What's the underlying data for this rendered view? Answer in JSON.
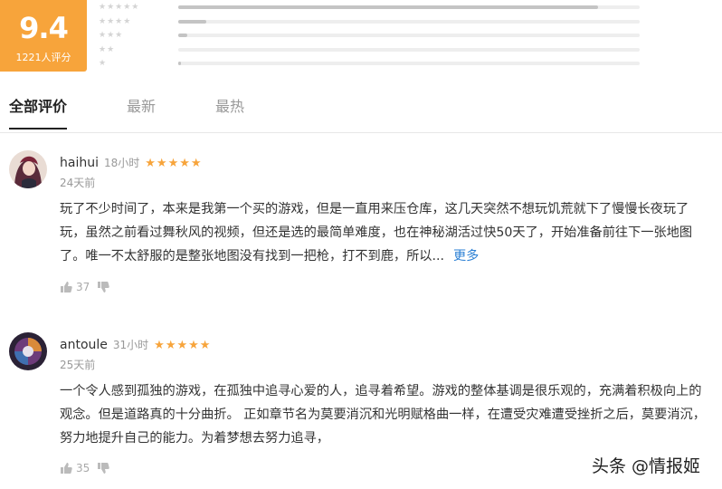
{
  "summary": {
    "score": "9.4",
    "count_label": "1221人评分",
    "distribution": [
      {
        "stars": 5,
        "fraction": 0.91
      },
      {
        "stars": 4,
        "fraction": 0.06
      },
      {
        "stars": 3,
        "fraction": 0.02
      },
      {
        "stars": 2,
        "fraction": 0.0
      },
      {
        "stars": 1,
        "fraction": 0.005
      }
    ]
  },
  "tabs": [
    {
      "label": "全部评价",
      "active": true
    },
    {
      "label": "最新",
      "active": false
    },
    {
      "label": "最热",
      "active": false
    }
  ],
  "reviews": [
    {
      "username": "haihui",
      "time_ago": "18小时",
      "rating": 5,
      "date": "24天前",
      "text": "玩了不少时间了，本来是我第一个买的游戏，但是一直用来压仓库，这几天突然不想玩饥荒就下了慢慢长夜玩了玩，虽然之前看过舞秋风的视频，但还是选的最简单难度，也在神秘湖活过快50天了，开始准备前往下一张地图了。唯一不太舒服的是整张地图没有找到一把枪，打不到鹿，所以...",
      "more_label": "更多",
      "likes": "37"
    },
    {
      "username": "antoule",
      "time_ago": "31小时",
      "rating": 5,
      "date": "25天前",
      "text": "一个令人感到孤独的游戏，在孤独中追寻心爱的人，追寻着希望。游戏的整体基调是很乐观的，充满着积极向上的观念。但是道路真的十分曲折。 正如章节名为莫要消沉和光明赋格曲一样，在遭受灾难遭受挫折之后，莫要消沉，努力地提升自己的能力。为着梦想去努力追寻，",
      "likes": "35"
    }
  ],
  "watermark": "头条 @情报姬",
  "colors": {
    "accent": "#f7a43b",
    "link": "#2a7fd4"
  }
}
